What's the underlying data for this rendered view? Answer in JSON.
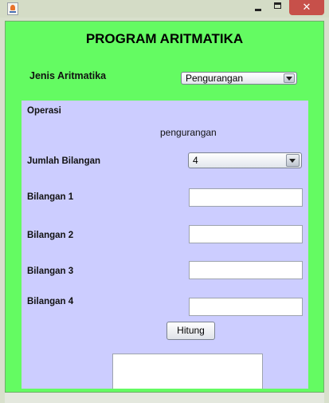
{
  "window": {
    "close_symbol": "✕",
    "icons": [
      "java-app-icon",
      "minimize-icon",
      "maximize-icon",
      "close-icon"
    ]
  },
  "header": {
    "title": "PROGRAM ARITMATIKA"
  },
  "jenis": {
    "label": "Jenis Aritmatika",
    "selected": "Pengurangan"
  },
  "panel": {
    "operasi_label": "Operasi",
    "operasi_value": "pengurangan",
    "jumlah_label": "Jumlah Bilangan",
    "jumlah_selected": "4",
    "bilangan": [
      {
        "label": "Bilangan 1",
        "value": ""
      },
      {
        "label": "Bilangan 2",
        "value": ""
      },
      {
        "label": "Bilangan 3",
        "value": ""
      },
      {
        "label": "Bilangan 4",
        "value": ""
      }
    ],
    "hitung_label": "Hitung",
    "result_value": ""
  },
  "colors": {
    "frame_bg": "#64fb62",
    "panel_bg": "#cccdff",
    "close_button": "#c7504a"
  }
}
